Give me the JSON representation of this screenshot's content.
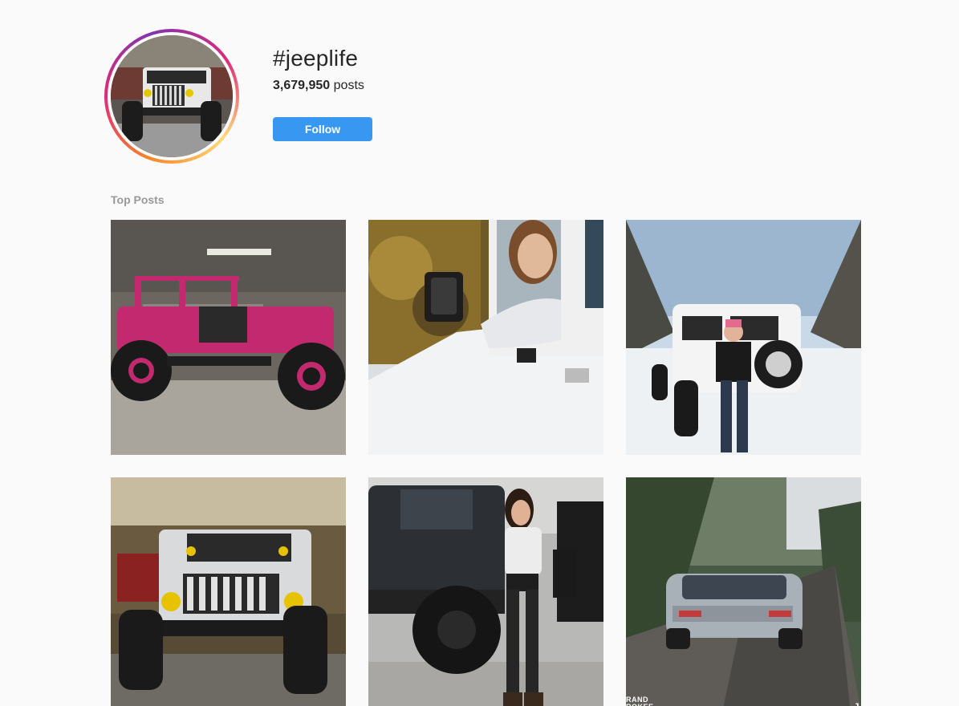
{
  "hashtag": {
    "title": "#jeeplife",
    "post_count": "3,679,950",
    "post_count_label": "posts",
    "follow_label": "Follow"
  },
  "sections": {
    "top_posts_label": "Top Posts"
  },
  "posts": [
    {
      "subject": "pink jeep in garage"
    },
    {
      "subject": "woman leaning out of white jeep window"
    },
    {
      "subject": "woman with white jeep in snow"
    },
    {
      "subject": "silver jeep with yellow lights in shop"
    },
    {
      "subject": "woman posing next to black jeep"
    },
    {
      "subject": "grey suv on forest road",
      "overlay_left": "RAND\nROKEE",
      "overlay_right": "J"
    }
  ],
  "colors": {
    "follow_bg": "#3897f0",
    "page_bg": "#fafafa",
    "section_label": "#999999"
  }
}
